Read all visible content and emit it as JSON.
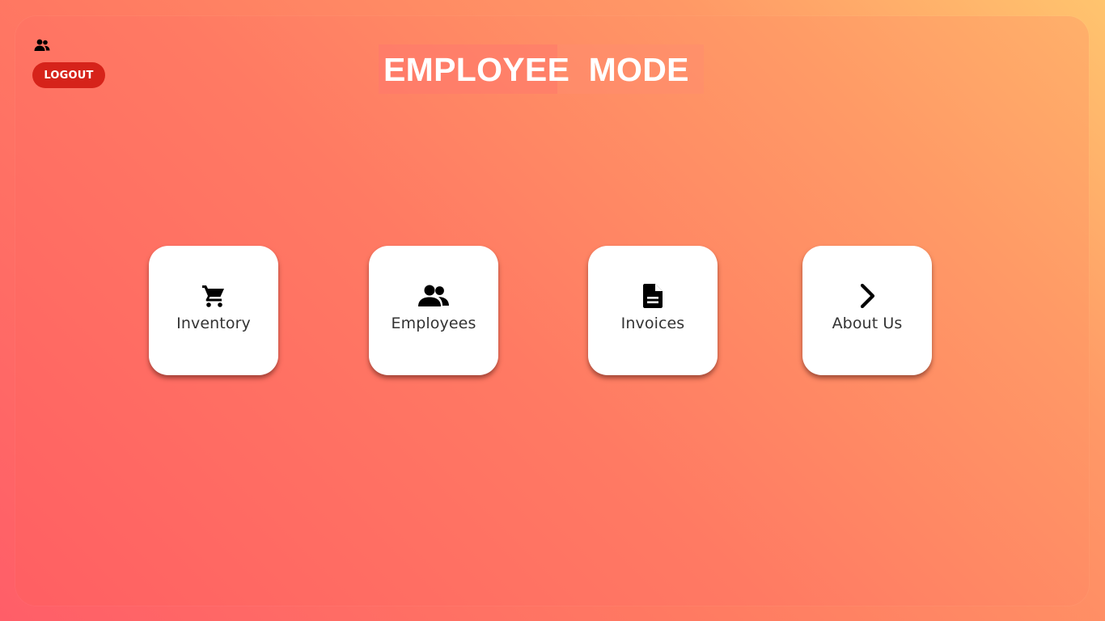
{
  "header": {
    "user_icon": "users-icon",
    "logout_label": "LOGOUT",
    "title": "EMPLOYEE  MODE"
  },
  "menu": {
    "items": [
      {
        "label": "Inventory",
        "icon": "cart-icon"
      },
      {
        "label": "Employees",
        "icon": "users-icon"
      },
      {
        "label": "Invoices",
        "icon": "document-icon"
      },
      {
        "label": "About Us",
        "icon": "chevron-right-icon"
      }
    ]
  },
  "colors": {
    "logout_button": "#d6231a",
    "card_background": "#ffffff",
    "title_text": "#ffffff"
  }
}
